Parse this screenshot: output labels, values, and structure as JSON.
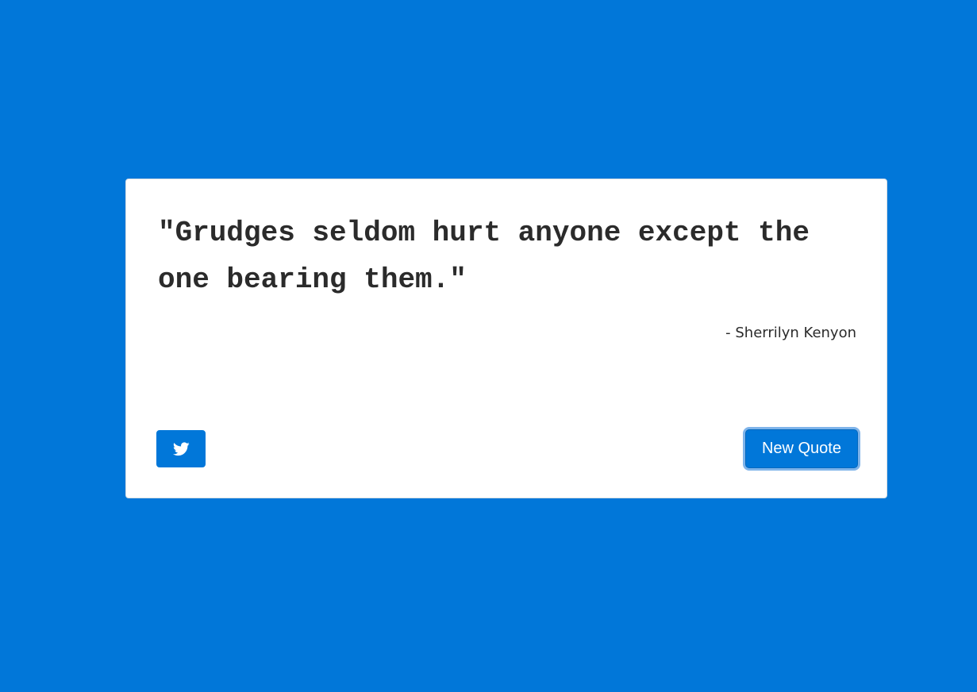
{
  "quote": {
    "text": "\"Grudges seldom hurt anyone except the one bearing them.\"",
    "author": "- Sherrilyn Kenyon"
  },
  "actions": {
    "tweet_icon": "twitter-icon",
    "new_quote_label": "New Quote"
  },
  "colors": {
    "background": "#0177d9",
    "card": "#ffffff",
    "text": "#2b2b2b",
    "button": "#0177d9",
    "focus_ring": "#7fb4ea"
  }
}
